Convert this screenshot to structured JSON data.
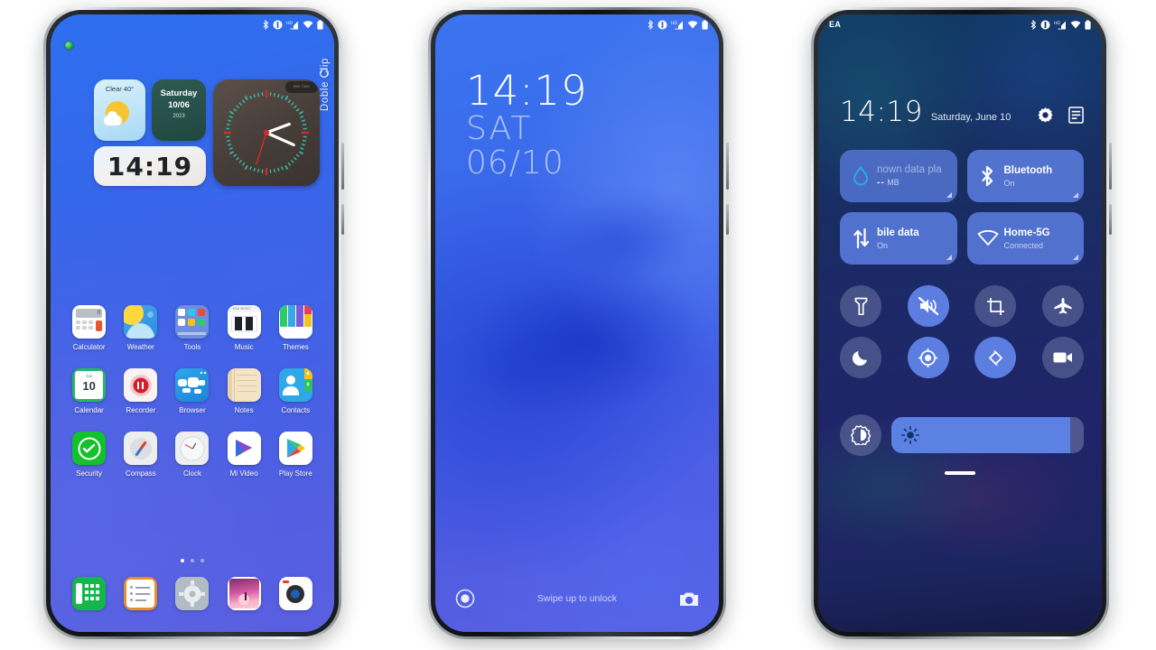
{
  "phone1": {
    "name": "home-screen",
    "statusbar": {
      "icons": [
        "bluetooth-icon",
        "vibrate-icon",
        "hd-signal-icon",
        "wifi-icon",
        "battery-icon"
      ]
    },
    "branding": {
      "label": "Doble Clip"
    },
    "widgets": {
      "weather": {
        "condition": "Clear 40°",
        "icon": "sun-cloud-icon"
      },
      "date": {
        "weekday": "Saturday",
        "date": "10/06",
        "year": "2023"
      },
      "digital_clock": {
        "time": "14:19"
      },
      "analog_clock": {
        "badge": "MIB TIME",
        "hour": 2,
        "minute": 19,
        "second": 33
      }
    },
    "apps": [
      [
        {
          "label": "Calculator",
          "icon": "calculator-icon"
        },
        {
          "label": "Weather",
          "icon": "weather-icon"
        },
        {
          "label": "Tools",
          "icon": "tools-icon"
        },
        {
          "label": "Music",
          "icon": "music-icon"
        },
        {
          "label": "Themes",
          "icon": "themes-icon"
        }
      ],
      [
        {
          "label": "Calendar",
          "icon": "calendar-icon",
          "day": "10",
          "dow": "Sat"
        },
        {
          "label": "Recorder",
          "icon": "recorder-icon"
        },
        {
          "label": "Browser",
          "icon": "browser-icon"
        },
        {
          "label": "Notes",
          "icon": "notes-icon"
        },
        {
          "label": "Contacts",
          "icon": "contacts-icon"
        }
      ],
      [
        {
          "label": "Security",
          "icon": "security-icon"
        },
        {
          "label": "Compass",
          "icon": "compass-icon"
        },
        {
          "label": "Clock",
          "icon": "clock-icon"
        },
        {
          "label": "Mi Video",
          "icon": "mi-video-icon"
        },
        {
          "label": "Play Store",
          "icon": "play-store-icon"
        }
      ]
    ],
    "page_indicator": {
      "count": 3,
      "active": 0
    },
    "dock": [
      {
        "icon": "phone-icon"
      },
      {
        "icon": "messages-icon"
      },
      {
        "icon": "settings-icon"
      },
      {
        "icon": "gallery-icon"
      },
      {
        "icon": "camera-icon"
      }
    ]
  },
  "phone2": {
    "name": "lock-screen",
    "statusbar": {
      "icons": [
        "bluetooth-icon",
        "vibrate-icon",
        "hd-signal-icon",
        "wifi-icon",
        "battery-icon"
      ]
    },
    "clock": {
      "time": "14:19",
      "weekday": "SAT",
      "date": "06/10"
    },
    "bottom": {
      "left_icon": "assistant-icon",
      "hint": "Swipe up to unlock",
      "right_icon": "camera-icon"
    }
  },
  "phone3": {
    "name": "quick-settings",
    "statusbar": {
      "carrier": "EA",
      "icons": [
        "bluetooth-icon",
        "vibrate-icon",
        "hd-signal-icon",
        "wifi-icon",
        "battery-icon"
      ]
    },
    "header": {
      "time": "14:19",
      "date": "Saturday, June 10",
      "settings_icon": "gear-icon",
      "edit_icon": "notes-list-icon"
    },
    "tiles": [
      {
        "title": "nown data pla",
        "subtitle": "",
        "value": "--",
        "unit": "MB",
        "icon": "data-usage-icon",
        "state": "off"
      },
      {
        "title": "Bluetooth",
        "subtitle": "On",
        "icon": "bluetooth-icon",
        "state": "on"
      },
      {
        "title": "bile data",
        "subtitle": "On",
        "icon": "mobile-data-icon",
        "state": "on"
      },
      {
        "title": "Home-5G",
        "subtitle": "Connected",
        "icon": "wifi-icon",
        "state": "on"
      }
    ],
    "toggles": [
      [
        {
          "name": "flashlight",
          "icon": "flashlight-icon",
          "state": "off"
        },
        {
          "name": "silent",
          "icon": "mute-icon",
          "state": "on"
        },
        {
          "name": "screenshot",
          "icon": "screenshot-icon",
          "state": "off"
        },
        {
          "name": "airplane-mode",
          "icon": "airplane-icon",
          "state": "off"
        }
      ],
      [
        {
          "name": "do-not-disturb",
          "icon": "moon-icon",
          "state": "off"
        },
        {
          "name": "location",
          "icon": "location-icon",
          "state": "on"
        },
        {
          "name": "auto-rotate",
          "icon": "auto-rotate-icon",
          "state": "on"
        },
        {
          "name": "screen-recorder",
          "icon": "video-camera-icon",
          "state": "off"
        }
      ]
    ],
    "brightness": {
      "icon": "brightness-auto-icon",
      "slider_icon": "sun-icon",
      "percent": 93
    }
  },
  "colors": {
    "accent_blue": "#3b74ef",
    "tile_blue": "#5c7ee0",
    "dark_navy": "#1b2a66",
    "white": "#ffffff"
  }
}
